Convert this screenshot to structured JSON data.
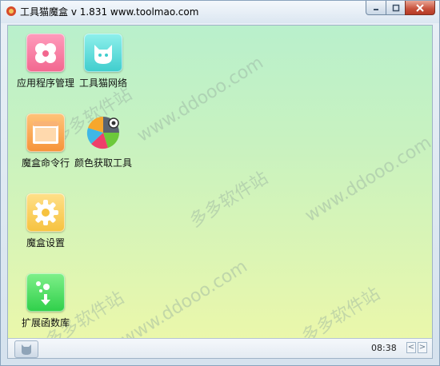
{
  "window": {
    "title": "工具猫魔盒 v 1.831 www.toolmao.com"
  },
  "desktop": {
    "icons": [
      {
        "label": "应用程序管理",
        "icon": "heart-flower-icon"
      },
      {
        "label": "工具猫网络",
        "icon": "cat-icon"
      },
      {
        "label": "魔盒命令行",
        "icon": "command-window-icon"
      },
      {
        "label": "颜色获取工具",
        "icon": "color-pie-icon"
      },
      {
        "label": "魔盒设置",
        "icon": "gear-icon"
      },
      {
        "label": "扩展函数库",
        "icon": "function-library-icon"
      }
    ]
  },
  "watermark": {
    "site_cn": "多多软件站",
    "site_url": "www.ddooo.com"
  },
  "statusbar": {
    "clock": "08:38",
    "prev": "<",
    "next": ">"
  },
  "colors": {
    "pink": "#f2678f",
    "cyan": "#3fcdcd",
    "orange": "#f6933a",
    "yellow": "#f6c23f",
    "green": "#2fcf4a",
    "close_button": "#c7503a"
  }
}
